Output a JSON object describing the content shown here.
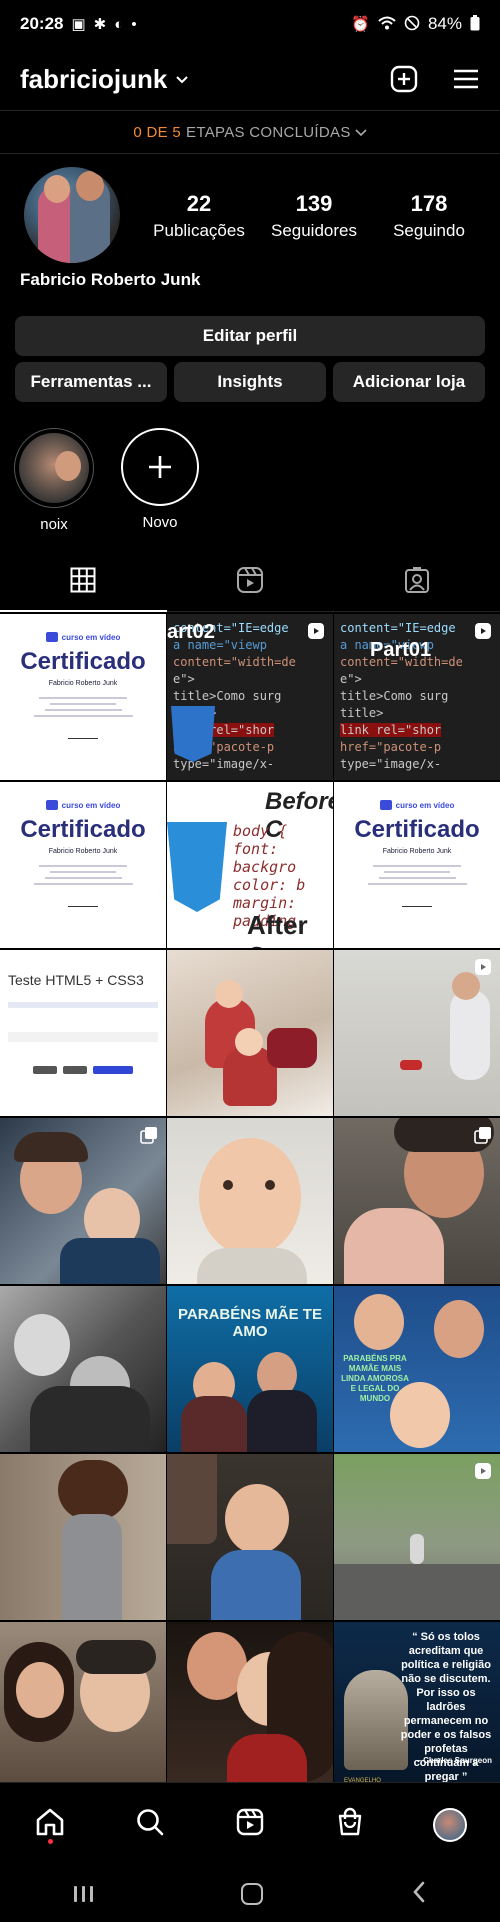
{
  "status_bar": {
    "time": "20:28",
    "battery": "84%",
    "icons_left": [
      "image-icon",
      "accessibility-icon",
      "cloud-app-icon",
      "dot-icon"
    ],
    "icons_right": [
      "alarm-icon",
      "wifi-icon",
      "do-not-disturb-icon",
      "battery-icon"
    ]
  },
  "header": {
    "username": "fabriciojunk",
    "create_icon": "plus-square-icon",
    "menu_icon": "hamburger-menu-icon"
  },
  "steps_banner": {
    "count": "0 DE 5",
    "label": "ETAPAS CONCLUÍDAS"
  },
  "profile": {
    "full_name": "Fabricio Roberto Junk",
    "stats": [
      {
        "value": "22",
        "label": "Publicações"
      },
      {
        "value": "139",
        "label": "Seguidores"
      },
      {
        "value": "178",
        "label": "Seguindo"
      }
    ]
  },
  "buttons": {
    "edit_profile": "Editar perfil",
    "tools": "Ferramentas ...",
    "insights": "Insights",
    "add_shop": "Adicionar loja"
  },
  "highlights": [
    {
      "label": "noix"
    },
    {
      "label": "Novo"
    }
  ],
  "tabs": [
    {
      "icon": "grid-icon",
      "active": true
    },
    {
      "icon": "reels-icon",
      "active": false
    },
    {
      "icon": "tagged-icon",
      "active": false
    }
  ],
  "posts": {
    "certificate": {
      "brand": "curso em vídeo",
      "title": "Certificado",
      "name": "Fabricio Roberto Junk"
    },
    "code_overlay_1": "art02",
    "code_overlay_2": "Part01",
    "code_lines": [
      "content=\"IE=edge",
      "a name=\"viewp",
      "content=\"width=de",
      "e\">",
      "title>Como surg",
      "title>",
      "link rel=\"shor",
      "href=\"pacote-p",
      "type=\"image/x-"
    ],
    "css_before": "Before C",
    "css_after": "After C",
    "css_code": [
      "body {",
      "  font:",
      "  backgro",
      "  color: b",
      "  margin:",
      "  padding"
    ],
    "test_title": "Teste HTML5 + CSS3",
    "mothers_day_text": "PARABÉNS MÃE TE AMO",
    "mothers_day_text_2": "PARABÉNS PRA MAMÃE MAIS LINDA AMOROSA E LEGAL DO MUNDO",
    "quote_text": "“ Só os tolos acreditam que política e religião não se discutem. Por isso os ladrões permanecem no poder e os falsos profetas continuam a pregar ”",
    "quote_author": "– Charles Spurgeon",
    "quote_logo": "EVANGELHO"
  },
  "bottom_nav": [
    "home-icon",
    "search-icon",
    "reels-icon",
    "shop-icon",
    "profile-avatar"
  ],
  "colors": {
    "background": "#000000",
    "button": "#262626",
    "accent_orange": "#f08a38",
    "notification_red": "#ff3040"
  }
}
